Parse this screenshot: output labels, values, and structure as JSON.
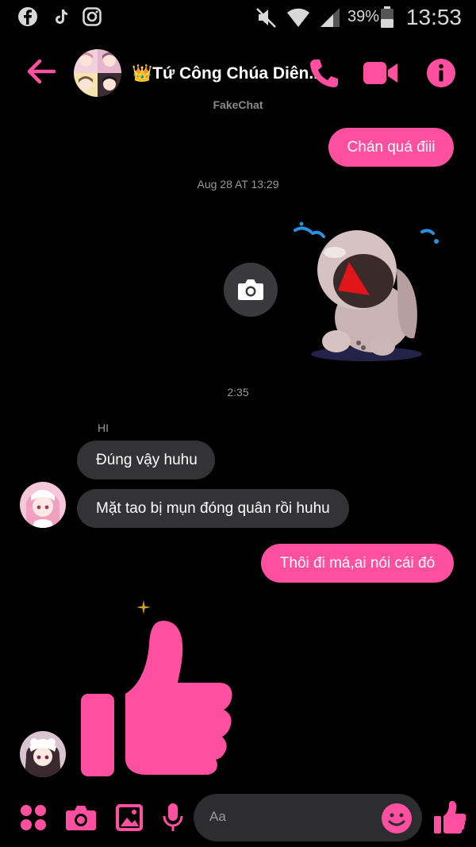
{
  "status_bar": {
    "battery": "39%",
    "time": "13:53",
    "icons": [
      "facebook-icon",
      "tiktok-icon",
      "instagram-icon",
      "mute-icon",
      "wifi-icon",
      "signal-icon",
      "battery-icon"
    ]
  },
  "header": {
    "title": "👑Tứ Công Chúa Diên...",
    "subtitle": "FakeChat",
    "icons": [
      "back-arrow-icon",
      "phone-icon",
      "video-call-icon",
      "info-icon"
    ]
  },
  "messages": {
    "m1": "Chán quá điii",
    "timestamp1": "Aug 28 AT 13:29",
    "timestamp2": "2:35",
    "sender_name": "HI",
    "m2": "Đúng vậy huhu",
    "m3": "Mặt tao bị mụn đóng quân rồi huhu",
    "m4": "Thôi đi má,ai nói cái đó"
  },
  "composer": {
    "placeholder": "Aa",
    "icons": [
      "apps-grid-icon",
      "camera-icon",
      "gallery-icon",
      "microphone-icon",
      "emoji-icon",
      "like-icon"
    ]
  },
  "colors": {
    "accent": "#ff4fa0",
    "background": "#000000",
    "incoming_bubble": "#333335",
    "composer_bg": "#2d2d2f"
  }
}
